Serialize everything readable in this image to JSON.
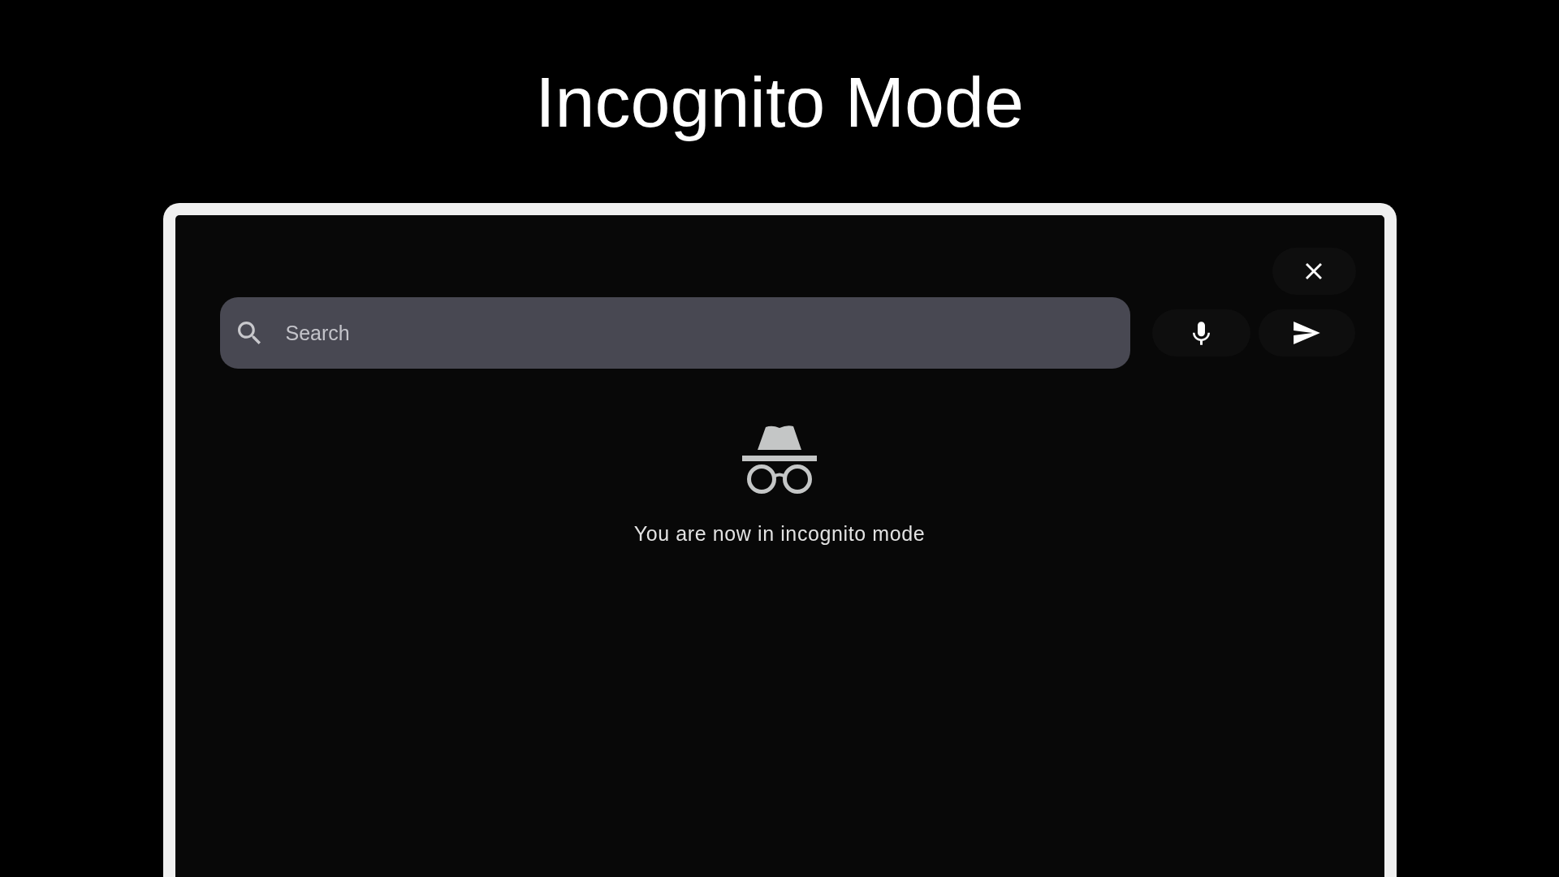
{
  "title": "Incognito Mode",
  "search": {
    "placeholder": "Search"
  },
  "message": "You are now in incognito mode"
}
